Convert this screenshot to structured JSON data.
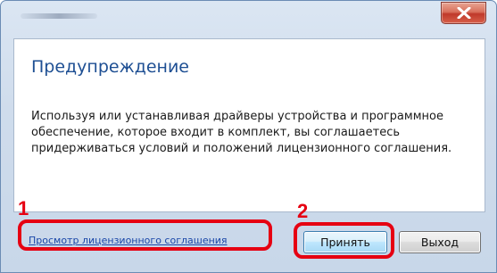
{
  "dialog": {
    "close_icon": "close-icon",
    "heading": "Предупреждение",
    "message": "Используя или устанавливая драйверы устройства и программное обеспечение, которое входит в комплект, вы соглашаетесь придерживаться условий и положений лицензионного соглашения.",
    "link_label": "Просмотр лицензионного соглашения",
    "accept_label": "Принять",
    "exit_label": "Выход"
  },
  "callouts": {
    "first": "1",
    "second": "2",
    "color": "#e60012"
  },
  "colors": {
    "heading": "#1e4f93",
    "link": "#1a46a8",
    "close_button": "#c0392b"
  }
}
